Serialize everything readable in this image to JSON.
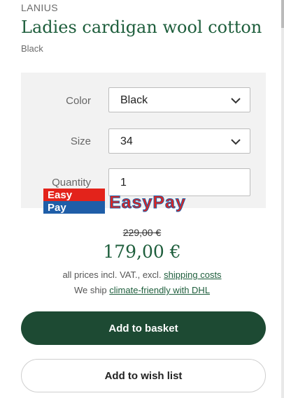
{
  "product": {
    "brand": "LANIUS",
    "title": "Ladies cardigan wool cotton",
    "variant": "Black"
  },
  "options": {
    "color": {
      "label": "Color",
      "value": "Black"
    },
    "size": {
      "label": "Size",
      "value": "34"
    },
    "quantity": {
      "label": "Quantity",
      "value": "1"
    }
  },
  "banner": {
    "logo_line1": "Easy",
    "logo_line2": "Pay",
    "wordmark": "EasyPay"
  },
  "pricing": {
    "old_price": "229,00 €",
    "new_price": "179,00 €",
    "vat_note": "all prices incl. VAT., excl. ",
    "shipping_link": "shipping costs",
    "ship_prefix": "We ship ",
    "climate_link": "climate-friendly with DHL"
  },
  "actions": {
    "basket_label": "Add to basket",
    "wishlist_label": "Add to wish list"
  },
  "colors": {
    "accent_green": "#1e5e3c",
    "button_dark": "#1d4a33",
    "easypay_red": "#e3231b",
    "easypay_blue": "#1f5ea8"
  }
}
